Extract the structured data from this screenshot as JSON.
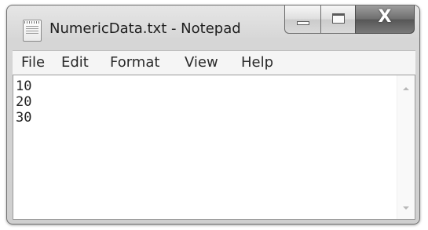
{
  "window": {
    "title": "NumericData.txt - Notepad",
    "app_icon": "notepad-icon"
  },
  "caption_buttons": {
    "minimize_icon": "minimize-icon",
    "maximize_icon": "maximize-icon",
    "close_icon": "close-icon",
    "close_glyph": "X"
  },
  "menu": {
    "items": [
      {
        "label": "File"
      },
      {
        "label": "Edit"
      },
      {
        "label": "Format"
      },
      {
        "label": "View"
      },
      {
        "label": "Help"
      }
    ]
  },
  "editor": {
    "content": "10\n20\n30"
  },
  "scrollbar": {
    "up_icon": "scroll-up-arrow-icon",
    "down_icon": "scroll-down-arrow-icon"
  }
}
